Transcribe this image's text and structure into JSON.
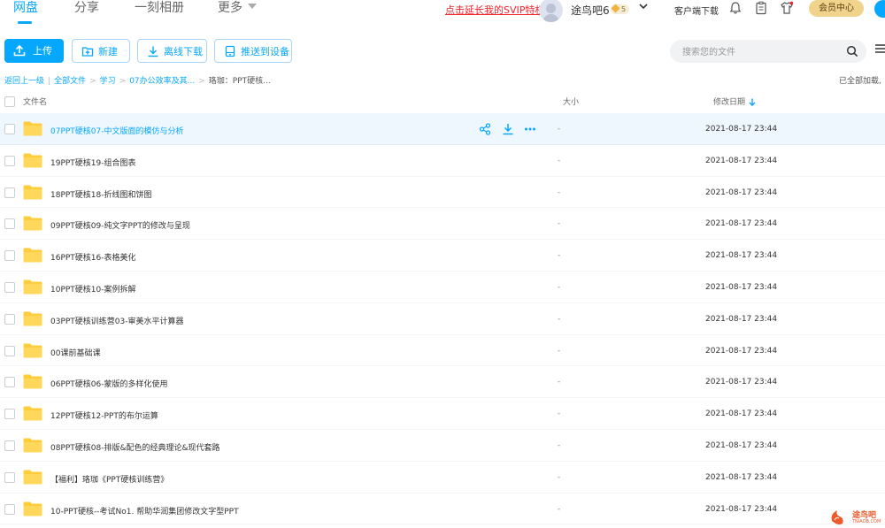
{
  "colors": {
    "accent": "#06a7ff",
    "svip_link": "#f5222d",
    "member": "#f0d48e",
    "folder": "#ffcd3c"
  },
  "nav": {
    "tabs": [
      "网盘",
      "分享",
      "一刻相册",
      "更多"
    ],
    "svip_link": "点击延长我的SVIP特权",
    "username": "途鸟吧6",
    "vip_level": "5",
    "client_download": "客户端下载",
    "member_center": "会员中心"
  },
  "toolbar": {
    "upload": "上传",
    "new": "新建",
    "offline_download": "离线下载",
    "push_device": "推送到设备",
    "search_placeholder": "搜索您的文件"
  },
  "breadcrumb": {
    "back": "返回上一级",
    "items": [
      "全部文件",
      "学习",
      "07办公效率及其...",
      "珞珈：PPT硬核..."
    ],
    "loaded": "已全部加载,"
  },
  "table": {
    "columns": {
      "name": "文件名",
      "size": "大小",
      "date": "修改日期"
    },
    "rows": [
      {
        "name": "07PPT硬核07-中文版面的模仿与分析",
        "size": "-",
        "date": "2021-08-17 23:44"
      },
      {
        "name": "19PPT硬核19-组合图表",
        "size": "-",
        "date": "2021-08-17 23:44"
      },
      {
        "name": "18PPT硬核18-折线图和饼图",
        "size": "-",
        "date": "2021-08-17 23:44"
      },
      {
        "name": "09PPT硬核09-纯文字PPT的修改与呈现",
        "size": "-",
        "date": "2021-08-17 23:44"
      },
      {
        "name": "16PPT硬核16-表格美化",
        "size": "-",
        "date": "2021-08-17 23:44"
      },
      {
        "name": "10PPT硬核10-案例拆解",
        "size": "-",
        "date": "2021-08-17 23:44"
      },
      {
        "name": "03PPT硬核训练营03-审美水平计算器",
        "size": "-",
        "date": "2021-08-17 23:44"
      },
      {
        "name": "00课前基础课",
        "size": "-",
        "date": "2021-08-17 23:44"
      },
      {
        "name": "06PPT硬核06-蒙版的多样化使用",
        "size": "-",
        "date": "2021-08-17 23:44"
      },
      {
        "name": "12PPT硬核12-PPT的布尔运算",
        "size": "-",
        "date": "2021-08-17 23:44"
      },
      {
        "name": "08PPT硬核08-排版&配色的经典理论&现代套路",
        "size": "-",
        "date": "2021-08-17 23:44"
      },
      {
        "name": "【福利】珞珈《PPT硬核训练营》",
        "size": "-",
        "date": "2021-08-17 23:44"
      },
      {
        "name": "10-PPT硬核--考试No1. 帮助华润集团修改文字型PPT",
        "size": "-",
        "date": "2021-08-17 23:44"
      }
    ]
  },
  "watermark": {
    "text": "途鸟吧",
    "sub": "TNIAOB.COM"
  }
}
